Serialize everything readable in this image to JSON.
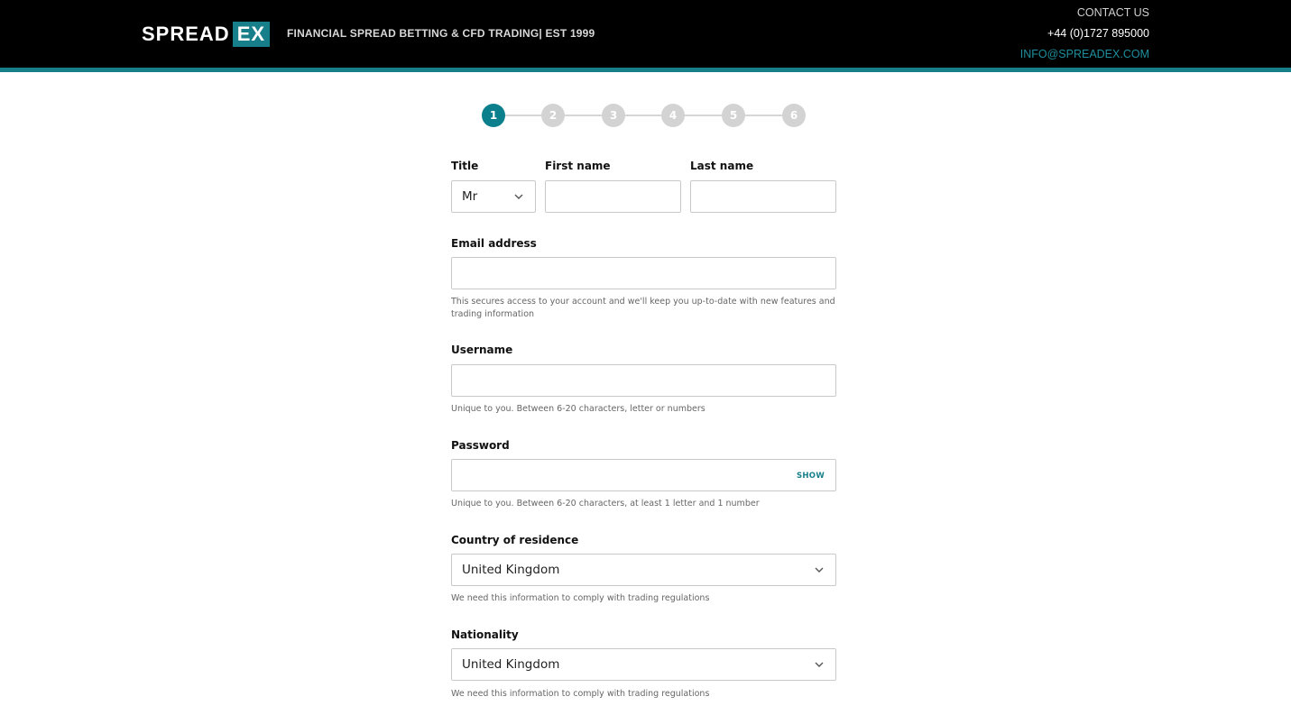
{
  "header": {
    "logo_primary": "SPREAD",
    "logo_secondary": "EX",
    "tagline": "FINANCIAL SPREAD BETTING & CFD TRADING| EST 1999",
    "contact_title": "CONTACT US",
    "contact_phone": "+44 (0)1727 895000",
    "contact_email": "INFO@SPREADEX.COM"
  },
  "stepper": {
    "active": 1,
    "steps": [
      "1",
      "2",
      "3",
      "4",
      "5",
      "6"
    ]
  },
  "form": {
    "title_label": "Title",
    "title_value": "Mr",
    "first_name_label": "First name",
    "first_name_value": "",
    "last_name_label": "Last name",
    "last_name_value": "",
    "email_label": "Email address",
    "email_value": "",
    "email_hint": "This secures access to your account and we'll keep you up-to-date with new features and trading information",
    "username_label": "Username",
    "username_value": "",
    "username_hint": "Unique to you. Between 6-20 characters, letter or numbers",
    "password_label": "Password",
    "password_value": "",
    "password_show": "SHOW",
    "password_hint": "Unique to you. Between 6-20 characters, at least 1 letter and 1 number",
    "country_label": "Country of residence",
    "country_value": "United Kingdom",
    "country_hint": "We need this information to comply with trading regulations",
    "nationality_label": "Nationality",
    "nationality_value": "United Kingdom",
    "nationality_hint": "We need this information to comply with trading regulations"
  },
  "colors": {
    "accent": "#167f8a",
    "header_bg": "#000000",
    "step_active": "#0b7f8c",
    "step_inactive": "#d3d3d3"
  },
  "icons": {
    "title_dropdown": "chevron-down-icon",
    "country_dropdown": "chevron-down-icon",
    "nationality_dropdown": "chevron-down-icon"
  }
}
